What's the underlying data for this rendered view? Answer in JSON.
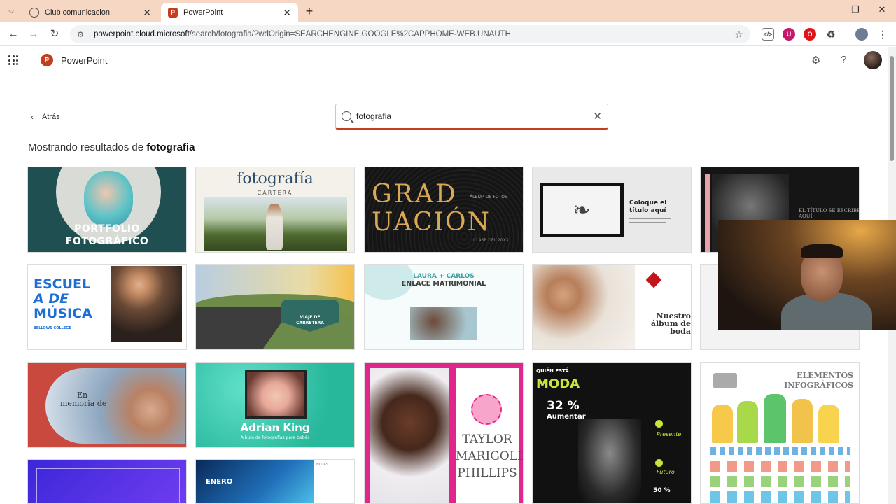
{
  "browser": {
    "tabs": [
      {
        "title": "Club comunicacion",
        "active": false
      },
      {
        "title": "PowerPoint",
        "active": true
      }
    ],
    "url_host": "powerpoint.cloud.microsoft",
    "url_path": "/search/fotografia/?wdOrigin=SEARCHENGINE.GOOGLE%2CAPPHOME-WEB.UNAUTH"
  },
  "app": {
    "name": "PowerPoint"
  },
  "nav": {
    "back_label": "Atrás"
  },
  "search": {
    "value": "fotografia"
  },
  "results": {
    "prefix": "Mostrando resultados de ",
    "query": "fotografia"
  },
  "templates": {
    "portfolio": {
      "line1": "PORTFOLIO",
      "line2": "FOTOGRÁFICO"
    },
    "cartera": {
      "title": "fotografía",
      "subtitle": "CARTERA"
    },
    "graduacion": {
      "line1": "GRAD",
      "line2": "UACIÓN",
      "album": "ÁLBUM DE FOTOS",
      "clase": "CLASE DEL 20XX"
    },
    "coloque": {
      "title": "Coloque el título aquí"
    },
    "elTitulo": {
      "title": "EL TÍTULO SE ESCRIBE AQUÍ"
    },
    "musica": {
      "line1": "ESCUEL",
      "line2": "A DE",
      "line3": "MÚSICA",
      "college": "BELLOWS COLLEGE"
    },
    "viaje": {
      "line1": "VIAJE DE",
      "line2": "CARRETERA"
    },
    "enlace": {
      "line1": "LAURA + CARLOS",
      "line2": "ENLACE MATRIMONIAL"
    },
    "boda": {
      "line1": "Nuestro",
      "line2": "álbum de",
      "line3": "boda"
    },
    "memoria": {
      "line1": "En",
      "line2": "memoria de"
    },
    "adrian": {
      "name": "Adrian King",
      "sub": "Álbum de fotografías para bebés"
    },
    "taylor": {
      "line1": "TAYLOR",
      "line2": "MARIGOLD",
      "line3": "PHILLIPS"
    },
    "moda": {
      "header": "QUIÉN ESTÁ",
      "title": "MODA",
      "pct": "32 %",
      "aumentar": "Aumentar",
      "presente": "Presente",
      "futuro": "Futuro",
      "pct2": "50 %"
    },
    "infografia": {
      "line1": "ELEMENTOS",
      "line2": "INFOGRÁFICOS"
    },
    "enero": {
      "title": "ENERO",
      "notas": "NOTAS"
    }
  }
}
